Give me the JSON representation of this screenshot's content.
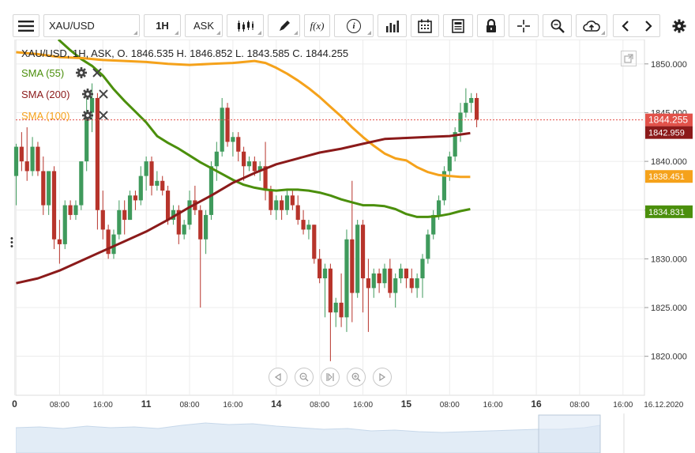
{
  "toolbar": {
    "menu_icon": "hamburger-icon",
    "symbol": "XAU/USD",
    "timeframe": "1H",
    "price_type": "ASK",
    "fx_label": "f(x)",
    "info_label": "i"
  },
  "legend": {
    "ohlc": "XAU/USD, 1H, ASK,   O. 1846.535 H. 1846.852 L. 1843.585 C. 1844.255",
    "sma": [
      {
        "label": "SMA (55)",
        "color": "#4b8f0c"
      },
      {
        "label": "SMA (200)",
        "color": "#8b1a1a"
      },
      {
        "label": "SMA (100)",
        "color": "#f5a21b"
      }
    ]
  },
  "colors": {
    "up": "#3f9a5c",
    "down": "#b7342b",
    "sma55": "#4b8f0c",
    "sma200": "#8b1a1a",
    "sma100": "#f5a21b",
    "current_price_bg": "#e2524a"
  },
  "chart_data": {
    "type": "candlestick",
    "y_axis": {
      "ylim": [
        1816,
        1852.5
      ],
      "ticks": [
        "1850.000",
        "1845.000",
        "1840.000",
        "1835.000",
        "1830.000",
        "1825.000",
        "1820.000"
      ]
    },
    "x_axis": {
      "ticks": [
        {
          "label": "0",
          "bar": -0.3,
          "bold": true
        },
        {
          "label": "08:00",
          "bar": 8
        },
        {
          "label": "16:00",
          "bar": 16
        },
        {
          "label": "11",
          "bar": 24,
          "bold": true
        },
        {
          "label": "08:00",
          "bar": 32
        },
        {
          "label": "16:00",
          "bar": 40
        },
        {
          "label": "14",
          "bar": 48,
          "bold": true
        },
        {
          "label": "08:00",
          "bar": 56
        },
        {
          "label": "16:00",
          "bar": 64
        },
        {
          "label": "15",
          "bar": 72,
          "bold": true
        },
        {
          "label": "08:00",
          "bar": 80
        },
        {
          "label": "16:00",
          "bar": 88
        },
        {
          "label": "16",
          "bar": 96,
          "bold": true
        },
        {
          "label": "08:00",
          "bar": 104
        },
        {
          "label": "16:00",
          "bar": 112
        },
        {
          "label": "16.12.2020",
          "bar": 119.5
        }
      ],
      "bar_count_visible": 122
    },
    "price_labels": [
      {
        "value": 1844.255,
        "text": "1844.255",
        "kind": "current"
      },
      {
        "value": 1842.959,
        "text": "1842.959",
        "kind": "sma200"
      },
      {
        "value": 1838.451,
        "text": "1838.451",
        "kind": "sma100"
      },
      {
        "value": 1834.831,
        "text": "1834.831",
        "kind": "sma55"
      }
    ],
    "candles": [
      [
        1838.5,
        1841.8,
        1835.5,
        1841.5
      ],
      [
        1841.5,
        1843.0,
        1839.0,
        1840.0
      ],
      [
        1840.0,
        1843.5,
        1838.0,
        1839.0
      ],
      [
        1839.0,
        1842.5,
        1838.5,
        1841.5
      ],
      [
        1841.5,
        1842.0,
        1838.5,
        1839.0
      ],
      [
        1839.0,
        1840.5,
        1834.5,
        1835.5
      ],
      [
        1835.5,
        1839.0,
        1834.5,
        1839.0
      ],
      [
        1839.0,
        1839.5,
        1831.0,
        1832.0
      ],
      [
        1832.0,
        1834.0,
        1829.5,
        1831.5
      ],
      [
        1831.5,
        1836.0,
        1831.0,
        1835.5
      ],
      [
        1835.5,
        1836.0,
        1834.0,
        1834.5
      ],
      [
        1834.5,
        1836.0,
        1834.0,
        1835.5
      ],
      [
        1835.5,
        1840.0,
        1835.0,
        1840.0
      ],
      [
        1840.0,
        1846.5,
        1839.0,
        1845.0
      ],
      [
        1845.0,
        1848.0,
        1843.0,
        1846.5
      ],
      [
        1846.5,
        1847.0,
        1833.0,
        1835.0
      ],
      [
        1835.0,
        1837.0,
        1832.0,
        1833.0
      ],
      [
        1833.0,
        1833.5,
        1830.0,
        1830.5
      ],
      [
        1830.5,
        1833.0,
        1830.0,
        1832.5
      ],
      [
        1832.5,
        1836.0,
        1832.0,
        1835.0
      ],
      [
        1835.0,
        1836.0,
        1832.5,
        1834.0
      ],
      [
        1834.0,
        1837.0,
        1834.0,
        1836.5
      ],
      [
        1836.5,
        1837.0,
        1835.0,
        1836.0
      ],
      [
        1836.0,
        1839.5,
        1835.5,
        1838.5
      ],
      [
        1838.5,
        1840.5,
        1837.0,
        1840.0
      ],
      [
        1840.0,
        1840.5,
        1836.5,
        1837.5
      ],
      [
        1837.5,
        1839.0,
        1837.0,
        1838.0
      ],
      [
        1838.0,
        1838.5,
        1836.5,
        1837.0
      ],
      [
        1837.0,
        1837.5,
        1833.5,
        1834.0
      ],
      [
        1834.0,
        1835.5,
        1833.5,
        1835.0
      ],
      [
        1835.0,
        1835.5,
        1831.5,
        1832.5
      ],
      [
        1832.5,
        1834.0,
        1832.0,
        1833.5
      ],
      [
        1833.5,
        1837.0,
        1833.0,
        1836.0
      ],
      [
        1836.0,
        1837.5,
        1834.5,
        1835.0
      ],
      [
        1835.0,
        1835.5,
        1825.0,
        1832.0
      ],
      [
        1832.0,
        1835.0,
        1830.5,
        1834.5
      ],
      [
        1834.5,
        1840.0,
        1834.0,
        1839.5
      ],
      [
        1839.5,
        1842.0,
        1838.0,
        1841.0
      ],
      [
        1841.0,
        1846.5,
        1840.5,
        1845.5
      ],
      [
        1845.5,
        1846.0,
        1841.5,
        1842.0
      ],
      [
        1842.0,
        1843.0,
        1840.5,
        1842.5
      ],
      [
        1842.5,
        1843.0,
        1840.0,
        1841.0
      ],
      [
        1841.0,
        1841.5,
        1838.0,
        1839.5
      ],
      [
        1839.5,
        1840.5,
        1839.0,
        1840.0
      ],
      [
        1840.0,
        1840.5,
        1838.5,
        1839.0
      ],
      [
        1839.0,
        1840.0,
        1838.0,
        1839.5
      ],
      [
        1839.5,
        1842.0,
        1836.0,
        1837.0
      ],
      [
        1837.0,
        1837.5,
        1834.5,
        1835.0
      ],
      [
        1835.0,
        1836.5,
        1834.0,
        1836.0
      ],
      [
        1836.0,
        1836.5,
        1834.0,
        1835.0
      ],
      [
        1835.0,
        1837.0,
        1834.5,
        1836.5
      ],
      [
        1836.5,
        1837.0,
        1835.0,
        1835.5
      ],
      [
        1835.5,
        1836.5,
        1833.5,
        1834.0
      ],
      [
        1834.0,
        1835.0,
        1832.5,
        1833.0
      ],
      [
        1833.0,
        1834.0,
        1832.0,
        1833.5
      ],
      [
        1833.5,
        1833.5,
        1829.5,
        1830.0
      ],
      [
        1830.0,
        1831.0,
        1827.5,
        1828.0
      ],
      [
        1828.0,
        1829.5,
        1824.0,
        1829.0
      ],
      [
        1829.0,
        1829.5,
        1819.5,
        1824.5
      ],
      [
        1824.5,
        1826.0,
        1823.0,
        1825.5
      ],
      [
        1825.5,
        1828.5,
        1823.0,
        1824.0
      ],
      [
        1824.0,
        1833.0,
        1822.5,
        1832.0
      ],
      [
        1832.0,
        1838.0,
        1823.5,
        1826.5
      ],
      [
        1826.5,
        1834.0,
        1826.0,
        1833.5
      ],
      [
        1833.5,
        1834.0,
        1824.5,
        1828.0
      ],
      [
        1828.0,
        1830.0,
        1822.5,
        1827.0
      ],
      [
        1827.0,
        1829.0,
        1826.0,
        1828.5
      ],
      [
        1828.5,
        1829.0,
        1826.5,
        1827.5
      ],
      [
        1827.5,
        1829.5,
        1827.0,
        1829.0
      ],
      [
        1829.0,
        1830.0,
        1826.0,
        1826.5
      ],
      [
        1826.5,
        1828.5,
        1825.0,
        1828.0
      ],
      [
        1828.0,
        1829.5,
        1827.5,
        1829.0
      ],
      [
        1829.0,
        1829.0,
        1827.0,
        1828.0
      ],
      [
        1828.0,
        1829.0,
        1826.5,
        1827.0
      ],
      [
        1827.0,
        1828.5,
        1826.0,
        1828.0
      ],
      [
        1828.0,
        1830.5,
        1826.0,
        1830.0
      ],
      [
        1830.0,
        1833.0,
        1829.5,
        1832.5
      ],
      [
        1832.5,
        1835.0,
        1832.0,
        1834.5
      ],
      [
        1834.5,
        1836.5,
        1834.0,
        1836.0
      ],
      [
        1836.0,
        1839.5,
        1835.5,
        1839.0
      ],
      [
        1839.0,
        1841.0,
        1838.0,
        1840.5
      ],
      [
        1840.5,
        1843.5,
        1840.0,
        1843.0
      ],
      [
        1843.0,
        1846.0,
        1842.0,
        1845.0
      ],
      [
        1845.0,
        1847.5,
        1844.5,
        1846.0
      ],
      [
        1846.0,
        1847.0,
        1845.0,
        1846.5
      ],
      [
        1846.5,
        1847.0,
        1843.5,
        1844.3
      ]
    ],
    "sma_series": [
      {
        "ref": "sma55",
        "points": [
          [
            7.8,
            1852.5
          ],
          [
            10,
            1851.4
          ],
          [
            12,
            1850.5
          ],
          [
            14,
            1849.8
          ],
          [
            16,
            1848.8
          ],
          [
            18,
            1847.4
          ],
          [
            20,
            1846.2
          ],
          [
            22,
            1845.1
          ],
          [
            24,
            1844.0
          ],
          [
            26,
            1842.6
          ],
          [
            28,
            1841.9
          ],
          [
            30,
            1841.3
          ],
          [
            32,
            1840.6
          ],
          [
            34,
            1839.9
          ],
          [
            36,
            1839.3
          ],
          [
            38,
            1838.7
          ],
          [
            40,
            1838.1
          ],
          [
            42,
            1837.6
          ],
          [
            44,
            1837.3
          ],
          [
            46,
            1837.1
          ],
          [
            48,
            1837.0
          ],
          [
            50,
            1837.1
          ],
          [
            52,
            1837.1
          ],
          [
            54,
            1837.0
          ],
          [
            56,
            1836.8
          ],
          [
            58,
            1836.5
          ],
          [
            60,
            1836.1
          ],
          [
            62,
            1835.8
          ],
          [
            64,
            1835.5
          ],
          [
            66,
            1835.5
          ],
          [
            68,
            1835.4
          ],
          [
            70,
            1835.1
          ],
          [
            72,
            1834.6
          ],
          [
            74,
            1834.3
          ],
          [
            76,
            1834.3
          ],
          [
            78,
            1834.4
          ],
          [
            80,
            1834.6
          ],
          [
            82,
            1834.9
          ],
          [
            83.8,
            1835.1
          ]
        ]
      },
      {
        "ref": "sma100",
        "points": [
          [
            0,
            1851.2
          ],
          [
            4,
            1851.0
          ],
          [
            8,
            1850.7
          ],
          [
            12,
            1850.6
          ],
          [
            16,
            1850.4
          ],
          [
            20,
            1850.3
          ],
          [
            24,
            1850.2
          ],
          [
            28,
            1850.0
          ],
          [
            32,
            1849.9
          ],
          [
            36,
            1850.0
          ],
          [
            40,
            1850.1
          ],
          [
            44,
            1850.3
          ],
          [
            46,
            1850.1
          ],
          [
            48,
            1849.6
          ],
          [
            50,
            1849.0
          ],
          [
            52,
            1848.3
          ],
          [
            54,
            1847.5
          ],
          [
            56,
            1846.6
          ],
          [
            58,
            1845.6
          ],
          [
            60,
            1844.6
          ],
          [
            62,
            1843.5
          ],
          [
            64,
            1842.5
          ],
          [
            66,
            1841.6
          ],
          [
            68,
            1840.8
          ],
          [
            70,
            1840.3
          ],
          [
            72,
            1840.1
          ],
          [
            74,
            1839.4
          ],
          [
            76,
            1838.9
          ],
          [
            78,
            1838.6
          ],
          [
            80,
            1838.5
          ],
          [
            82,
            1838.4
          ],
          [
            83.8,
            1838.4
          ]
        ]
      },
      {
        "ref": "sma200",
        "points": [
          [
            0,
            1827.5
          ],
          [
            4,
            1828.0
          ],
          [
            8,
            1828.8
          ],
          [
            12,
            1829.8
          ],
          [
            16,
            1830.8
          ],
          [
            20,
            1831.8
          ],
          [
            24,
            1832.8
          ],
          [
            28,
            1834.0
          ],
          [
            32,
            1835.3
          ],
          [
            36,
            1836.5
          ],
          [
            40,
            1837.8
          ],
          [
            44,
            1838.8
          ],
          [
            48,
            1839.7
          ],
          [
            52,
            1840.3
          ],
          [
            56,
            1840.9
          ],
          [
            60,
            1841.3
          ],
          [
            64,
            1841.8
          ],
          [
            68,
            1842.3
          ],
          [
            72,
            1842.4
          ],
          [
            76,
            1842.5
          ],
          [
            80,
            1842.6
          ],
          [
            83.8,
            1842.9
          ]
        ]
      }
    ]
  }
}
